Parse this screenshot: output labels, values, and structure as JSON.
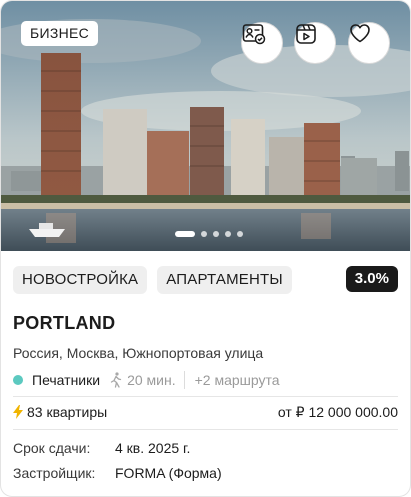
{
  "badge": "БИЗНЕС",
  "actions": [
    {
      "icon": "id-card-check-icon"
    },
    {
      "icon": "video-play-icon"
    },
    {
      "icon": "heart-icon"
    }
  ],
  "gallery": {
    "slides": 5,
    "active": 1
  },
  "tags": [
    "НОВОСТРОЙКА",
    "АПАРТАМЕНТЫ"
  ],
  "rate": "3.0%",
  "title": "PORTLAND",
  "address": "Россия, Москва, Южнопортовая улица",
  "metro": {
    "station": "Печатники",
    "walk_time": "20 мин.",
    "routes": "+2 маршрута",
    "line_color": "#5cc9c0"
  },
  "flats": "83 квартиры",
  "price": "от ₽ 12 000 000.00",
  "details": [
    {
      "label": "Срок сдачи:",
      "value": "4 кв. 2025 г."
    },
    {
      "label": "Застройщик:",
      "value": "FORMA (Форма)"
    }
  ],
  "colors": {
    "accent": "#1a1a1a",
    "bolt": "#f0b400",
    "metro": "#5cc9c0"
  }
}
